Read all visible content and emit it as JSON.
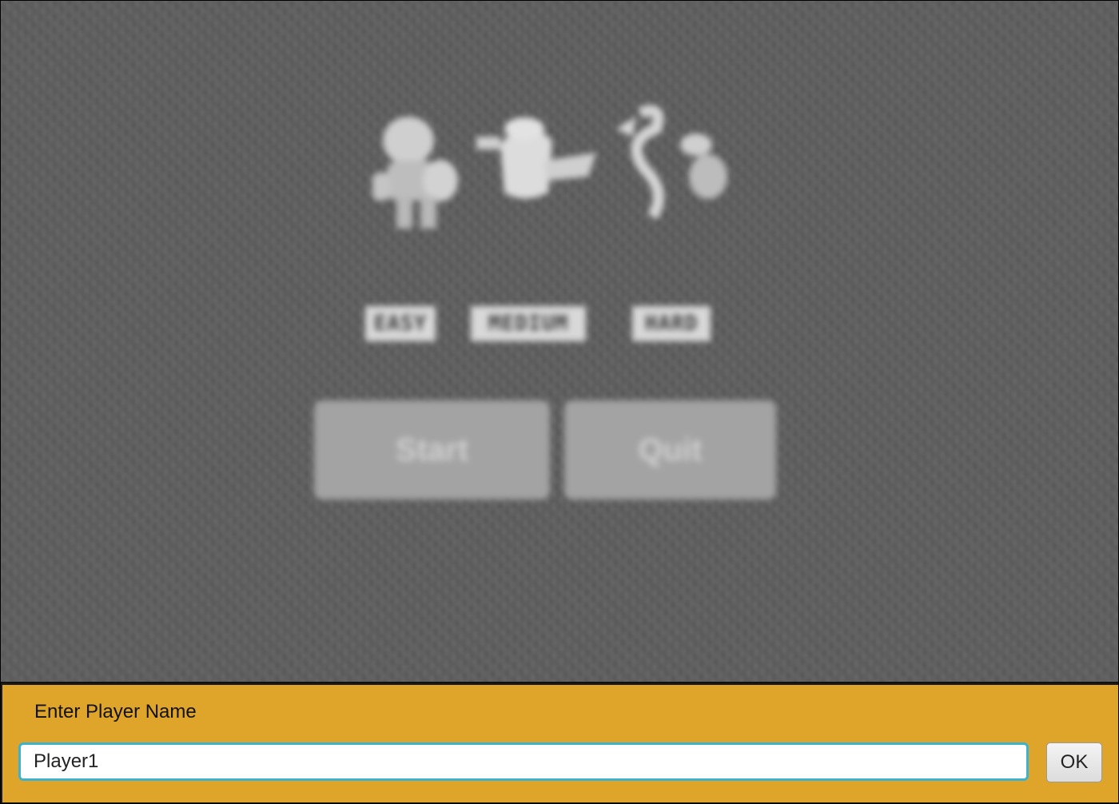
{
  "menu": {
    "difficulties": [
      {
        "label": "EASY",
        "character_icon": "mario-icon"
      },
      {
        "label": "MEDIUM",
        "character_icon": "ghost-icon"
      },
      {
        "label": "HARD",
        "character_icon": "dragon-icon"
      }
    ],
    "start_label": "Start",
    "quit_label": "Quit"
  },
  "name_dialog": {
    "prompt": "Enter Player Name",
    "input_value": "Player1",
    "ok_label": "OK",
    "panel_color": "#dfa52a",
    "input_focus_color": "#3bb2d0"
  }
}
